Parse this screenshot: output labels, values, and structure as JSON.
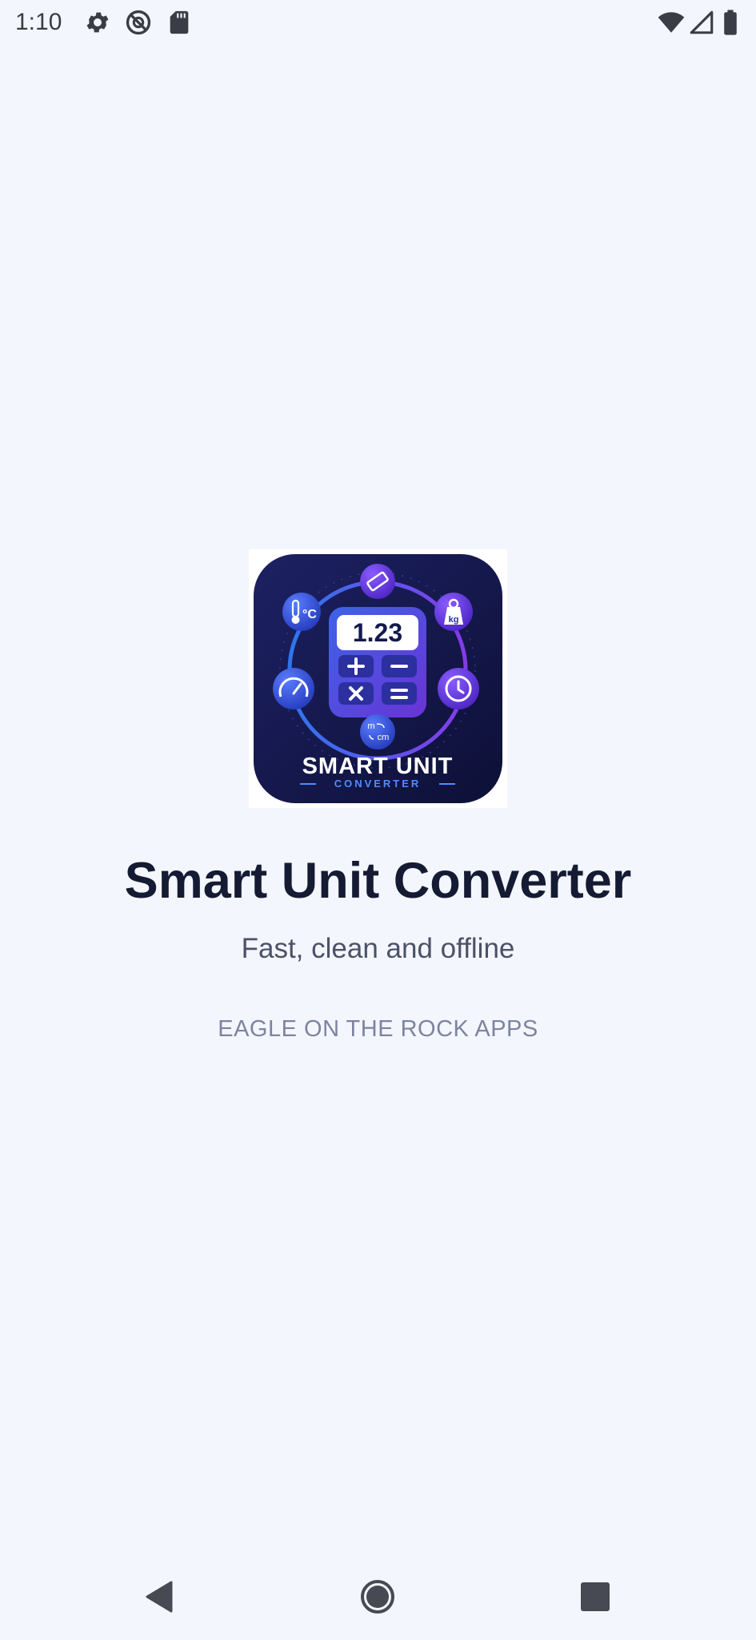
{
  "status_bar": {
    "time": "1:10",
    "left_icons": [
      "settings-icon",
      "no-tracking-icon",
      "sd-card-icon"
    ],
    "right_icons": [
      "wifi-icon",
      "cell-signal-icon",
      "battery-icon"
    ]
  },
  "splash": {
    "logo": {
      "icon": "app-logo-icon",
      "display_value": "1.23",
      "wordmark_line1": "SMART UNIT",
      "wordmark_line2": "CONVERTER",
      "badge_temperature": "°C",
      "badge_weight": "kg",
      "badge_length_top": "m",
      "badge_length_bottom": "cm",
      "colors": {
        "background": "#141a4d",
        "accent_blue": "#3b6cf0",
        "accent_purple": "#7c3aed"
      }
    },
    "title": "Smart Unit Converter",
    "tagline": "Fast, clean and offline",
    "publisher": "EAGLE ON THE ROCK APPS"
  },
  "nav_bar": {
    "back": "back-icon",
    "home": "home-icon",
    "recents": "recents-icon"
  },
  "colors": {
    "page_background": "#f4f6fd",
    "title_text": "#141b33",
    "tagline_text": "#4b5268",
    "publisher_text": "#7d84a0"
  }
}
